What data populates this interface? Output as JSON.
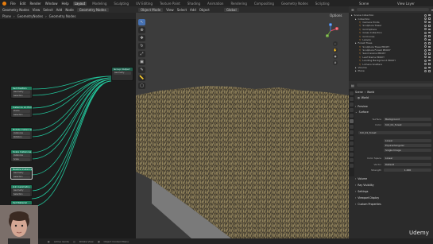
{
  "menu": {
    "items": [
      "File",
      "Edit",
      "Render",
      "Window",
      "Help"
    ],
    "workspaces": [
      "Layout",
      "Modeling",
      "Sculpting",
      "UV Editing",
      "Texture Paint",
      "Shading",
      "Animation",
      "Rendering",
      "Compositing",
      "Geometry Nodes",
      "Scripting"
    ],
    "active_workspace": "Layout",
    "scene": "Scene",
    "view_layer": "View Layer"
  },
  "node_editor": {
    "header": [
      "Geometry Nodes",
      "View",
      "Select",
      "Add",
      "Node"
    ],
    "modifier": "Geometry Nodes",
    "breadcrumb": [
      "Plane",
      "GeometryNodes",
      "Geometry Nodes"
    ],
    "group_output": {
      "title": "Group Output",
      "socket": "Geometry"
    },
    "nodes": [
      {
        "title": "Set Position",
        "rows": [
          "Geometry",
          "Selection"
        ]
      },
      {
        "title": "Instance on Points",
        "rows": [
          "Points",
          "Selection"
        ]
      },
      {
        "title": "Rotate Instances",
        "rows": [
          "Instances",
          "Rotation"
        ]
      },
      {
        "title": "Scale Instances",
        "rows": [
          "Instances",
          "Scale"
        ]
      },
      {
        "title": "Realize Instances",
        "rows": [
          "Geometry",
          "Selection"
        ]
      },
      {
        "title": "Join Geometry",
        "rows": [
          "Geometry",
          "Selection"
        ]
      },
      {
        "title": "Set Material",
        "rows": [
          "Geometry",
          "Material"
        ]
      }
    ]
  },
  "viewport": {
    "header": [
      "Object Mode",
      "View",
      "Select",
      "Add",
      "Object"
    ],
    "transform": "Global",
    "options": "Options",
    "gizmo_axes": [
      "X",
      "Y",
      "Z"
    ]
  },
  "outliner": {
    "rows": [
      {
        "label": "Scene Collection",
        "indent": 0
      },
      {
        "label": "Collection",
        "indent": 1
      },
      {
        "label": "Camera Prints",
        "indent": 2
      },
      {
        "label": "Sculpture Tower",
        "indent": 2
      },
      {
        "label": "Grid Sphere",
        "indent": 2
      },
      {
        "label": "Grass Collection",
        "indent": 2
      },
      {
        "label": "Grid Lines",
        "indent": 2
      },
      {
        "label": "Leaves",
        "indent": 2
      },
      {
        "label": "Forest Trees",
        "indent": 1
      },
      {
        "label": "Sculpture Trees PROXY",
        "indent": 2
      },
      {
        "label": "Sculpture Forest PROXY",
        "indent": 2
      },
      {
        "label": "Sand Grains PROXY",
        "indent": 2
      },
      {
        "label": "Leaf Stems PROXY",
        "indent": 2
      },
      {
        "label": "Landing Background PROXY",
        "indent": 2
      },
      {
        "label": "Lichens Scatters",
        "indent": 2
      },
      {
        "label": "Volume",
        "indent": 1
      },
      {
        "label": "Plane",
        "indent": 1
      }
    ]
  },
  "properties": {
    "header": "Scene",
    "object": "World",
    "sections": {
      "preview": "Preview",
      "surface": "Surface",
      "volume": "Volume",
      "ray_visibility": "Ray Visibility",
      "settings": "Settings",
      "viewport_display": "Viewport Display",
      "custom_properties": "Custom Properties"
    },
    "fields": {
      "surface_label": "Surface",
      "surface_value": "Background",
      "color_label": "Color",
      "color_value": "hdr_01_forest",
      "image_name": "hdr_01_forest",
      "interp": "Linear",
      "projection": "Equirectangular",
      "source": "Single Image",
      "color_space_label": "Color Space",
      "color_space": "Linear",
      "vector_label": "Vector",
      "vector_value": "Default",
      "strength_label": "Strength",
      "strength_value": "1.000"
    }
  },
  "status": [
    "Active Guide",
    "Rotate View",
    "Object Context Menu"
  ],
  "watermark": "Udemy"
}
